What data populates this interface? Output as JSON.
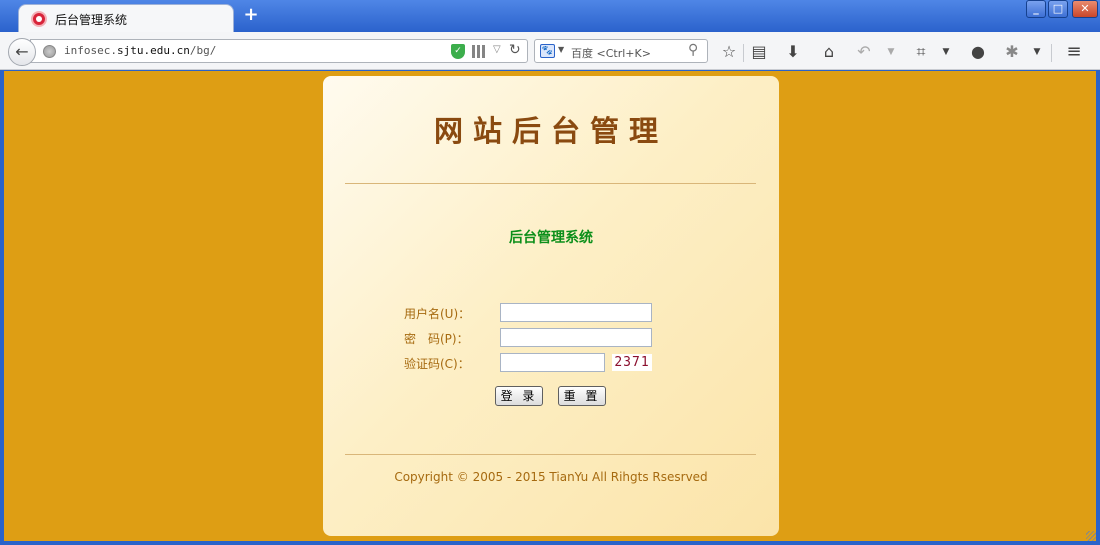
{
  "browser": {
    "tab": {
      "title": "后台管理系统"
    },
    "new_tab_glyph": "+",
    "url": {
      "prefix": "infosec.",
      "domain": "sjtu.edu.cn",
      "path": "/bg/"
    },
    "search": {
      "engine_glyph": "🐾",
      "placeholder": "百度 <Ctrl+K>"
    },
    "icons": [
      "back-arrow-icon",
      "globe-icon",
      "shield-icon",
      "qr-code-icon",
      "reload-icon",
      "baidu-icon",
      "magnifier-icon",
      "bookmark-star-icon",
      "reading-list-icon",
      "download-icon",
      "home-icon",
      "undo-icon",
      "screenshot-crop-icon",
      "chat-bubble-icon",
      "extension-icon",
      "menu-icon"
    ]
  },
  "page": {
    "title": "网站后台管理",
    "subtitle": "后台管理系统",
    "form": {
      "username_label": "用户名(U)：",
      "password_label": "密　码(P)：",
      "captcha_label": "验证码(C)：",
      "username_value": "",
      "password_value": "",
      "captcha_value": "",
      "captcha_code": "2371"
    },
    "buttons": {
      "login": "登 录",
      "reset": "重 置"
    },
    "copyright": "Copyright © 2005 - 2015 TianYu All Rihgts Rsesrved"
  },
  "colors": {
    "background": "#de9e14",
    "card_gradient_start": "#fffbef",
    "card_gradient_end": "#fbe4a9",
    "title": "#8a4a10",
    "subtitle": "#0c8f1a",
    "label": "#a66a10",
    "captcha": "#8b0f2e",
    "browser_frame": "#2a63c9"
  }
}
